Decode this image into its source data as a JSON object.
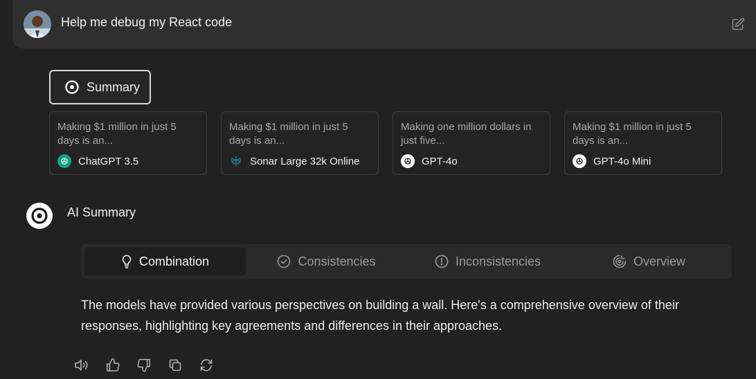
{
  "header": {
    "prompt": "Help me debug my React code"
  },
  "summary_pill": {
    "label": "Summary"
  },
  "cards": [
    {
      "preview": "Making $1 million in just 5 days is an...",
      "model": "ChatGPT 3.5",
      "icon": "openai-green-icon"
    },
    {
      "preview": "Making $1 million in just 5 days is an...",
      "model": "Sonar Large 32k Online",
      "icon": "perplexity-icon"
    },
    {
      "preview": "Making one million dollars in just five...",
      "model": "GPT-4o",
      "icon": "openai-icon"
    },
    {
      "preview": "Making $1 million in just 5 days is an...",
      "model": "GPT-4o Mini",
      "icon": "openai-icon"
    }
  ],
  "ai_summary": {
    "title": "AI Summary",
    "tabs": [
      {
        "label": "Combination",
        "icon": "lightbulb-icon",
        "active": true
      },
      {
        "label": "Consistencies",
        "icon": "check-circle-icon",
        "active": false
      },
      {
        "label": "Inconsistencies",
        "icon": "alert-circle-icon",
        "active": false
      },
      {
        "label": "Overview",
        "icon": "overview-icon",
        "active": false
      }
    ],
    "body": "The models have provided various perspectives on building a wall. Here's a comprehensive overview of their responses, highlighting key agreements and differences in their approaches."
  },
  "actions": [
    "speaker-icon",
    "thumbs-up-icon",
    "thumbs-down-icon",
    "copy-icon",
    "regenerate-icon"
  ],
  "colors": {
    "background": "#212121",
    "panel": "#2f2f2f",
    "openai_green": "#10a37f",
    "perplexity_teal": "#20808d"
  }
}
